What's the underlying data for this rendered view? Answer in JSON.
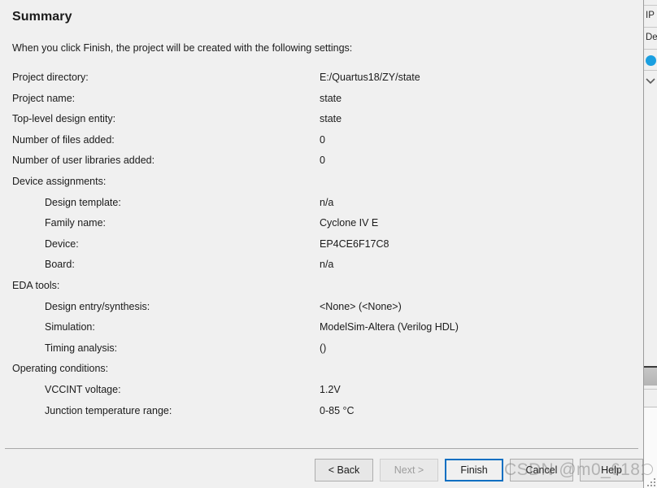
{
  "dialog": {
    "title": "Summary",
    "intro": "When you click Finish, the project will be created with the following settings:",
    "rows": [
      {
        "label": "Project directory:",
        "value": "E:/Quartus18/ZY/state",
        "indent": false
      },
      {
        "label": "Project name:",
        "value": "state",
        "indent": false
      },
      {
        "label": "Top-level design entity:",
        "value": "state",
        "indent": false
      },
      {
        "label": "Number of files added:",
        "value": "0",
        "indent": false
      },
      {
        "label": "Number of user libraries added:",
        "value": "0",
        "indent": false
      },
      {
        "label": "Device assignments:",
        "value": "",
        "indent": false
      },
      {
        "label": "Design template:",
        "value": "n/a",
        "indent": true
      },
      {
        "label": "Family name:",
        "value": "Cyclone IV E",
        "indent": true
      },
      {
        "label": "Device:",
        "value": "EP4CE6F17C8",
        "indent": true
      },
      {
        "label": "Board:",
        "value": "n/a",
        "indent": true
      },
      {
        "label": "EDA tools:",
        "value": "",
        "indent": false
      },
      {
        "label": "Design entry/synthesis:",
        "value": "<None> (<None>)",
        "indent": true
      },
      {
        "label": "Simulation:",
        "value": "ModelSim-Altera (Verilog HDL)",
        "indent": true
      },
      {
        "label": "Timing analysis:",
        "value": "()",
        "indent": true
      },
      {
        "label": "Operating conditions:",
        "value": "",
        "indent": false
      },
      {
        "label": "VCCINT voltage:",
        "value": "1.2V",
        "indent": true
      },
      {
        "label": "Junction temperature range:",
        "value": "0-85 °C",
        "indent": true
      }
    ]
  },
  "buttons": {
    "back": "< Back",
    "next": "Next >",
    "finish": "Finish",
    "cancel": "Cancel",
    "help": "Help"
  },
  "watermark": {
    "text": "CSDN @m0_61811389"
  },
  "right_strip": {
    "item_ip": "IP",
    "item_details": "De",
    "dot_color": "#1a9fe0"
  },
  "colors": {
    "background": "#f0f0f0",
    "text": "#1b1b1b",
    "separator": "#a9a9a9",
    "focus_border": "#0a6fc2",
    "button_face": "#e7e7e7",
    "disabled_text": "#9d9d9d"
  }
}
